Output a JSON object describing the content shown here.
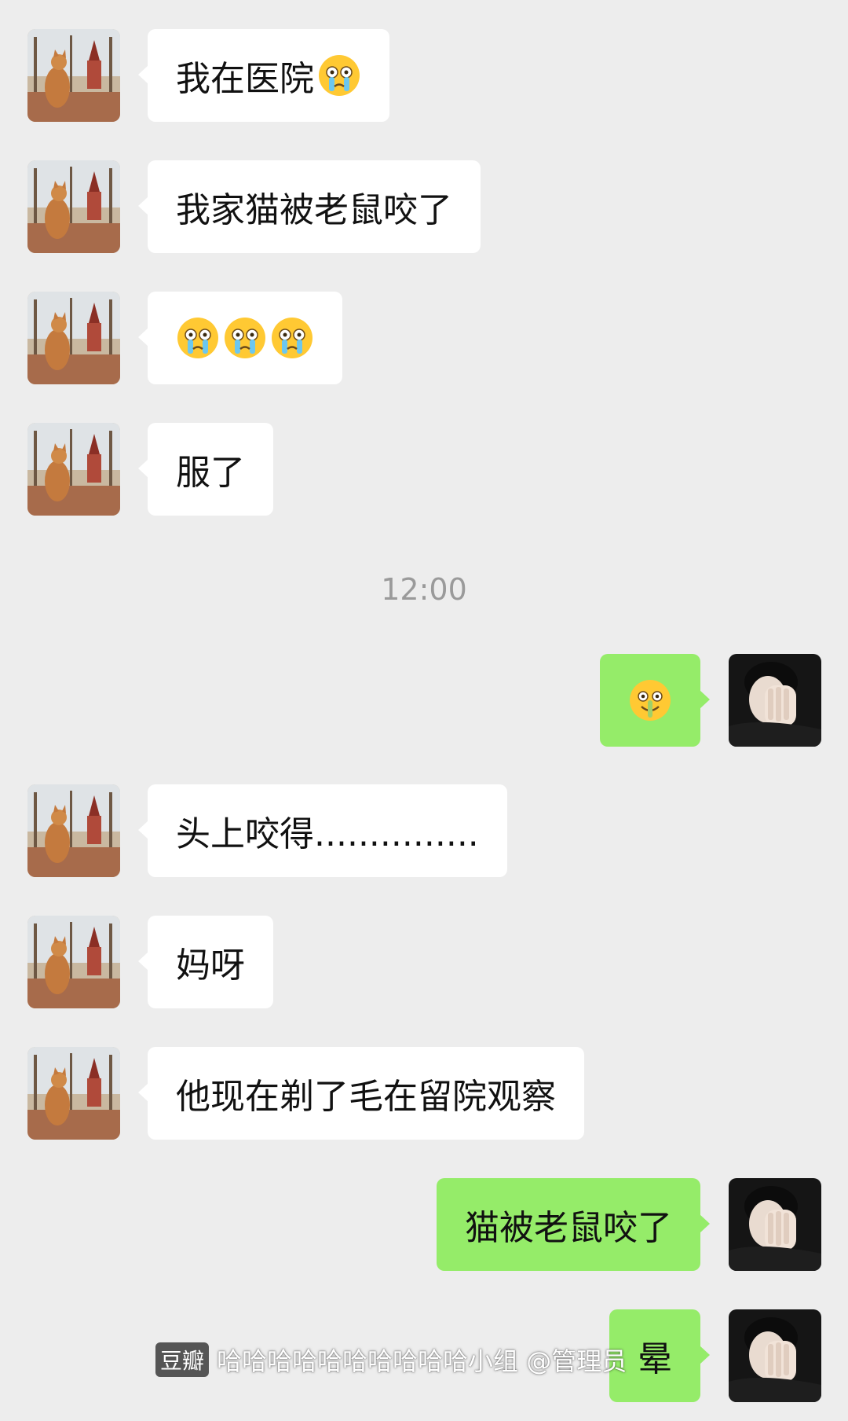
{
  "colors": {
    "background": "#ededed",
    "incoming_bubble": "#ffffff",
    "outgoing_bubble": "#95ec69",
    "timestamp_text": "#9a9a9a"
  },
  "messages": [
    {
      "side": "left",
      "text": "我在医院",
      "emoji": [
        "crying-face-emoji"
      ]
    },
    {
      "side": "left",
      "text": "我家猫被老鼠咬了"
    },
    {
      "side": "left",
      "text": "",
      "emoji": [
        "crying-face-emoji",
        "crying-face-emoji",
        "crying-face-emoji"
      ]
    },
    {
      "side": "left",
      "text": "服了"
    },
    {
      "side": "right",
      "text": "",
      "emoji": [
        "smile-with-tears-emoji"
      ]
    },
    {
      "side": "left",
      "text": "头上咬得..............."
    },
    {
      "side": "left",
      "text": "妈呀"
    },
    {
      "side": "left",
      "text": "他现在剃了毛在留院观察"
    },
    {
      "side": "right",
      "text": "猫被老鼠咬了"
    },
    {
      "side": "right",
      "text": "晕"
    }
  ],
  "timestamp": "12:00",
  "watermark": {
    "logo_text": "豆瓣",
    "text": "哈哈哈哈哈哈哈哈哈哈小组 @管理员"
  },
  "avatars": {
    "left": "cat-at-window-avatar",
    "right": "man-covering-face-avatar"
  }
}
